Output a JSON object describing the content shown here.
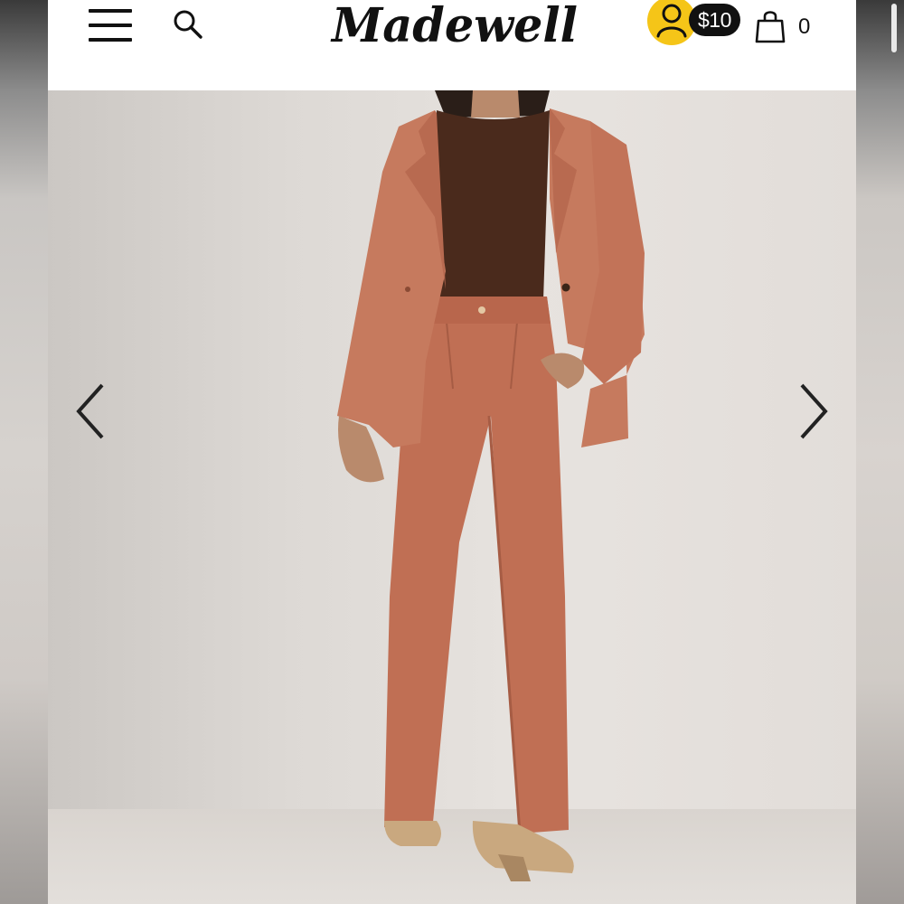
{
  "header": {
    "brand": "Madewell",
    "rewards_amount": "$10",
    "bag_count": "0"
  },
  "icons": [
    "menu-icon",
    "search-icon",
    "user-icon",
    "shopping-bag-icon",
    "chevron-left-icon",
    "chevron-right-icon"
  ],
  "colors": {
    "rewards_yellow": "#f5c518",
    "suit_rust": "#c67a5e",
    "top_brown": "#4a2a1c"
  }
}
